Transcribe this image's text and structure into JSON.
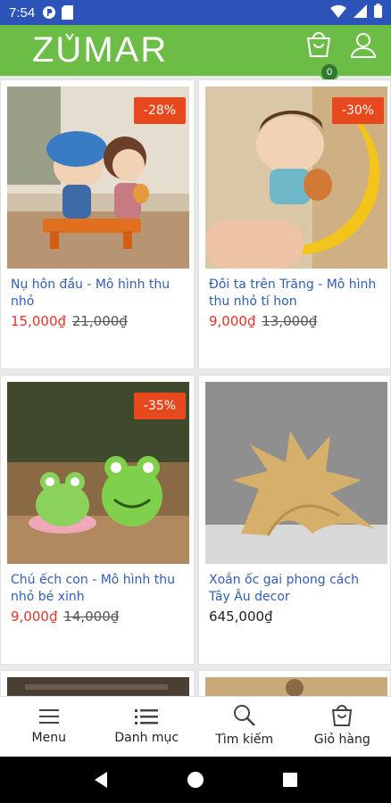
{
  "status_bar": {
    "time": "7:54"
  },
  "app_bar": {
    "logo": "ZUMAR",
    "cart_count": "0"
  },
  "colors": {
    "brand_green": "#6cbd45",
    "status_blue": "#2c53b8",
    "sale_red": "#e53227",
    "badge_orange": "#e8481d",
    "title_blue": "#2f5fb3"
  },
  "products": [
    {
      "title": "Nụ hôn đầu - Mô hình thu nhỏ",
      "price": "15,000₫",
      "old_price": "21,000₫",
      "discount": "-28%"
    },
    {
      "title": "Đôi ta trên Trăng - Mô hình thu nhỏ tí hon",
      "price": "9,000₫",
      "old_price": "13,000₫",
      "discount": "-30%"
    },
    {
      "title": "Chú ếch con - Mô hình thu nhỏ bé xinh",
      "price": "9,000₫",
      "old_price": "14,000₫",
      "discount": "-35%"
    },
    {
      "title": "Xoắn ốc gai phong cách Tây Âu decor",
      "price": "645,000₫"
    }
  ],
  "bottom_nav": [
    {
      "label": "Menu",
      "icon": "hamburger-icon"
    },
    {
      "label": "Danh mục",
      "icon": "list-icon"
    },
    {
      "label": "Tìm kiếm",
      "icon": "search-icon"
    },
    {
      "label": "Giỏ hàng",
      "icon": "shopping-bag-icon"
    }
  ]
}
